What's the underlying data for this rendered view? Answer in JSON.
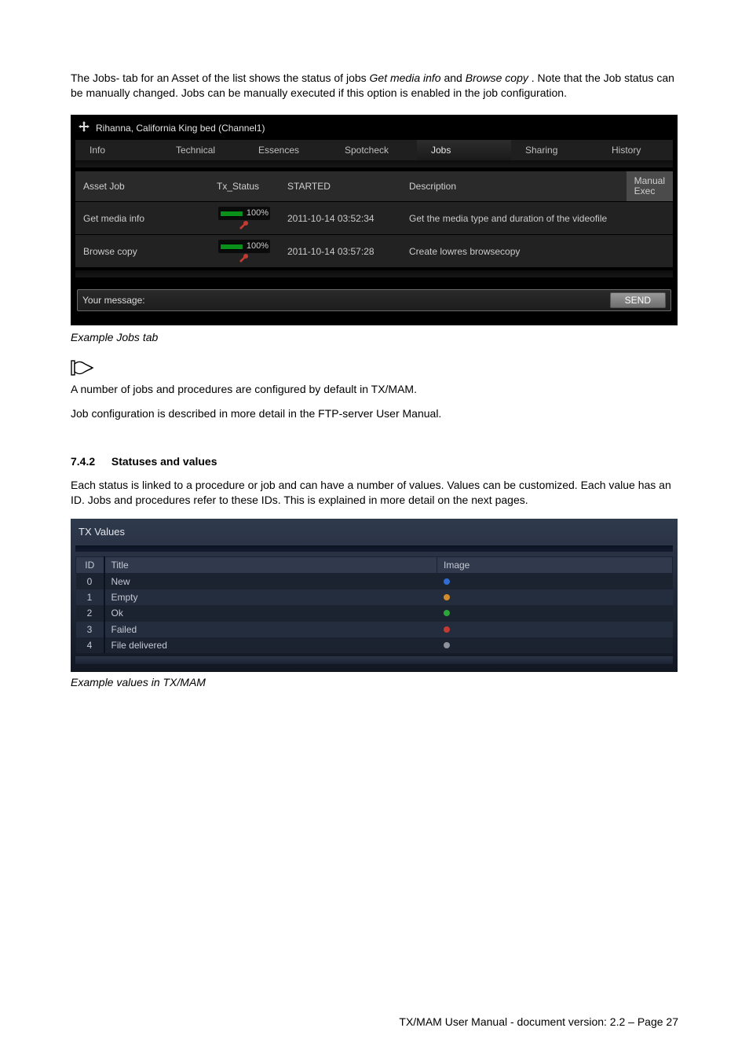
{
  "intro": {
    "p1_a": "The Jobs- tab for an Asset of the list shows the status of jobs ",
    "p1_em1": "Get media info",
    "p1_b": " and ",
    "p1_em2": "Browse copy",
    "p1_c": ". Note that the Job status can be manually changed. Jobs can be manually executed if this option is enabled in the job configuration."
  },
  "jobs_panel": {
    "title": "Rihanna, California King bed (Channel1)",
    "tabs": [
      "Info",
      "Technical",
      "Essences",
      "Spotcheck",
      "Jobs",
      "Sharing",
      "History"
    ],
    "active_tab_index": 4,
    "columns": {
      "asset_job": "Asset Job",
      "tx_status": "Tx_Status",
      "started": "STARTED",
      "description": "Description",
      "manual_exec_l1": "Manual",
      "manual_exec_l2": "Exec"
    },
    "rows": [
      {
        "job": "Get media info",
        "pct": "100%",
        "started": "2011-10-14 03:52:34",
        "desc": "Get the media type and duration of the videofile"
      },
      {
        "job": "Browse copy",
        "pct": "100%",
        "started": "2011-10-14 03:57:28",
        "desc": "Create lowres browsecopy"
      }
    ],
    "message_label": "Your message:",
    "send_label": "SEND"
  },
  "caption1": "Example Jobs tab",
  "note1": "A number of jobs and procedures are configured by default in TX/MAM.",
  "note2": "Job configuration is described in more detail in the FTP-server User Manual.",
  "section": {
    "num": "7.4.2",
    "title": "Statuses and values"
  },
  "section_text": "Each status is linked to a procedure or job and can have a number of values. Values can be customized. Each value has an ID. Jobs and procedures refer to these IDs. This is explained in more detail on the next pages.",
  "tx_values": {
    "title": "TX Values",
    "headers": {
      "id": "ID",
      "title": "Title",
      "image": "Image"
    },
    "rows": [
      {
        "id": "0",
        "title": "New",
        "dot": "blue"
      },
      {
        "id": "1",
        "title": "Empty",
        "dot": "orange"
      },
      {
        "id": "2",
        "title": "Ok",
        "dot": "green"
      },
      {
        "id": "3",
        "title": "Failed",
        "dot": "red"
      },
      {
        "id": "4",
        "title": "File delivered",
        "dot": "gray"
      }
    ]
  },
  "caption2": "Example values in TX/MAM",
  "footer": "TX/MAM User Manual - document version: 2.2 – Page 27"
}
